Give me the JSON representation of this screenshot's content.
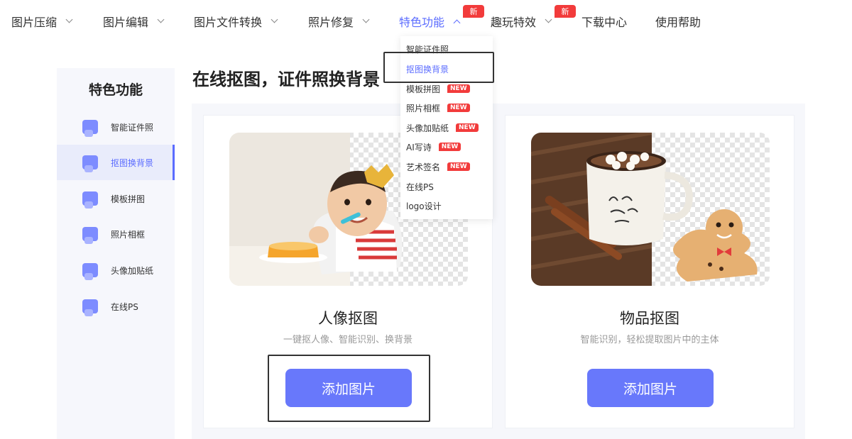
{
  "nav": {
    "items": [
      {
        "label": "图片压缩"
      },
      {
        "label": "图片编辑"
      },
      {
        "label": "图片文件转换"
      },
      {
        "label": "照片修复"
      },
      {
        "label": "特色功能"
      },
      {
        "label": "趣玩特效"
      },
      {
        "label": "下载中心"
      },
      {
        "label": "使用帮助"
      }
    ],
    "new_badge": "新"
  },
  "dropdown": {
    "items": [
      {
        "label": "智能证件照"
      },
      {
        "label": "抠图换背景"
      },
      {
        "label": "模板拼图"
      },
      {
        "label": "照片相框"
      },
      {
        "label": "头像加贴纸"
      },
      {
        "label": "AI写诗"
      },
      {
        "label": "艺术签名"
      },
      {
        "label": "在线PS"
      },
      {
        "label": "logo设计"
      }
    ],
    "new_tag": "NEW"
  },
  "sidebar": {
    "title": "特色功能",
    "items": [
      {
        "label": "智能证件照"
      },
      {
        "label": "抠图换背景"
      },
      {
        "label": "模板拼图"
      },
      {
        "label": "照片相框"
      },
      {
        "label": "头像加贴纸"
      },
      {
        "label": "在线PS"
      }
    ]
  },
  "page": {
    "title": "在线抠图，证件照换背景"
  },
  "cards": [
    {
      "title": "人像抠图",
      "desc": "一键抠人像、智能识别、换背景",
      "button": "添加图片"
    },
    {
      "title": "物品抠图",
      "desc": "智能识别，轻松提取图片中的主体",
      "button": "添加图片"
    }
  ],
  "colors": {
    "accent": "#5b6cff",
    "button": "#6878fb",
    "badge": "#f23b3b"
  }
}
